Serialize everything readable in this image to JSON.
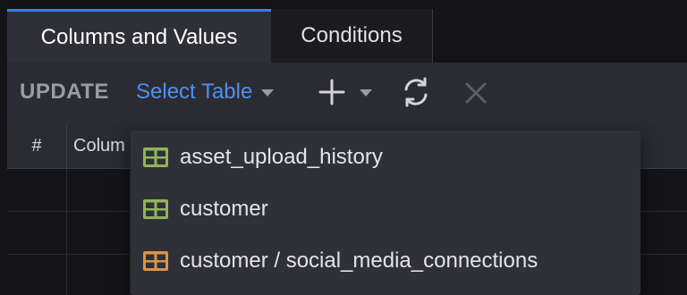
{
  "tabs": [
    {
      "label": "Columns and Values",
      "active": true
    },
    {
      "label": "Conditions",
      "active": false
    }
  ],
  "toolbar": {
    "statement_label": "UPDATE",
    "select_table_label": "Select Table",
    "add_icon": "plus-icon",
    "refresh_icon": "refresh-icon",
    "close_icon": "close-icon"
  },
  "grid": {
    "headers": [
      "#",
      "Colum"
    ]
  },
  "dropdown": {
    "items": [
      {
        "label": "asset_upload_history",
        "icon": "table-icon",
        "icon_color": "#8fb55c"
      },
      {
        "label": "customer",
        "icon": "table-icon",
        "icon_color": "#8fb55c"
      },
      {
        "label": "customer / social_media_connections",
        "icon": "table-icon",
        "icon_color": "#d9944a"
      }
    ]
  },
  "colors": {
    "accent": "#3d7fe0",
    "link": "#4f8ff0"
  }
}
